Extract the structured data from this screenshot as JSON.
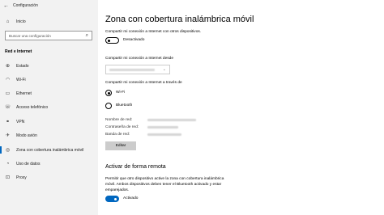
{
  "window": {
    "back_glyph": "←",
    "title": "Configuración"
  },
  "sidebar": {
    "home": {
      "icon": "home-icon",
      "glyph": "⌂",
      "label": "Inicio"
    },
    "search": {
      "placeholder": "Buscar una configuración",
      "icon": "search-icon"
    },
    "section_label": "Red e Internet",
    "items": [
      {
        "icon": "globe-icon",
        "glyph": "⊕",
        "label": "Estado"
      },
      {
        "icon": "wifi-icon",
        "glyph": "◠",
        "label": "Wi-Fi"
      },
      {
        "icon": "ethernet-icon",
        "glyph": "▭",
        "label": "Ethernet"
      },
      {
        "icon": "dialup-icon",
        "glyph": "☏",
        "label": "Acceso telefónico"
      },
      {
        "icon": "vpn-icon",
        "glyph": "⚭",
        "label": "VPN"
      },
      {
        "icon": "airplane-icon",
        "glyph": "✈",
        "label": "Modo avión"
      },
      {
        "icon": "hotspot-icon",
        "glyph": "◎",
        "label": "Zona con cobertura inalámbrica móvil",
        "active": true
      },
      {
        "icon": "data-usage-icon",
        "glyph": "◔",
        "label": "Uso de datos"
      },
      {
        "icon": "proxy-icon",
        "glyph": "⊡",
        "label": "Proxy"
      }
    ]
  },
  "main": {
    "title": "Zona con cobertura inalámbrica móvil",
    "share_label": "Compartir mi conexión a Internet con otros dispositivos.",
    "share_toggle": {
      "state": "off",
      "label": "Desactivado"
    },
    "from_label": "Compartir mi conexión a Internet desde",
    "via_label": "Compartir mi conexión a Internet a través de",
    "via_options": [
      {
        "label": "Wi-Fi",
        "selected": true
      },
      {
        "label": "Bluetooth",
        "selected": false
      }
    ],
    "network_name_label": "Nombre de red:",
    "password_label": "Contraseña de red:",
    "band_label": "Banda de red:",
    "edit_button": "Editar",
    "remote_heading": "Activar de forma remota",
    "remote_desc_line1": "Permitir que otro dispositivo active la zona con cobertura inalámbrica",
    "remote_desc_line2": "móvil. Ambos dispositivos deben tener el Bluetooth activado y estar",
    "remote_desc_line3": "emparejados.",
    "remote_toggle": {
      "state": "on",
      "label": "Activado"
    }
  },
  "colors": {
    "accent": "#0067c0",
    "sidebar_bg": "#f2f2f2",
    "button_bg": "#cccccc"
  }
}
